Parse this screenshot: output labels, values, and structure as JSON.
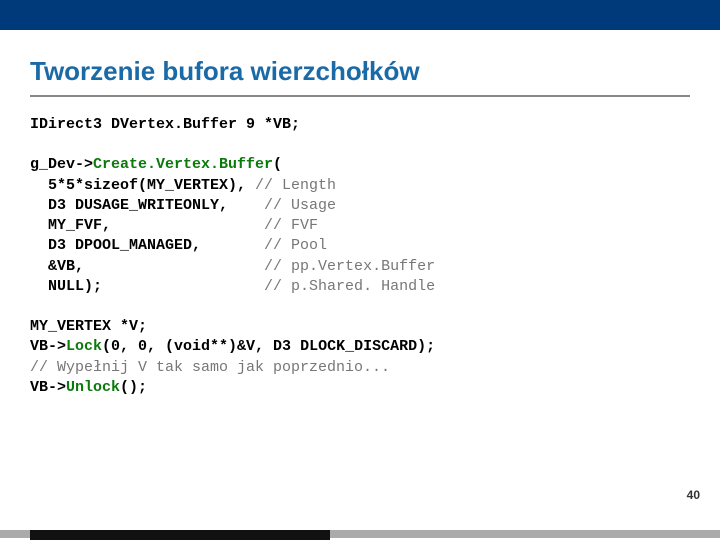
{
  "title": "Tworzenie bufora wierzchołków",
  "page_number": "40",
  "code1": {
    "line": "IDirect3 DVertex.Buffer 9 *VB;"
  },
  "code2": {
    "l1a": "g_Dev->",
    "l1b": "Create.Vertex.Buffer",
    "l1c": "(",
    "l2a": "  5*5*sizeof(MY_VERTEX), ",
    "l2c": "// Length",
    "l3a": "  D3 DUSAGE_WRITEONLY,    ",
    "l3c": "// Usage",
    "l4a": "  MY_FVF,                 ",
    "l4c": "// FVF",
    "l5a": "  D3 DPOOL_MANAGED,       ",
    "l5c": "// Pool",
    "l6a": "  &VB,                    ",
    "l6c": "// pp.Vertex.Buffer",
    "l7a": "  NULL);                  ",
    "l7c": "// p.Shared. Handle"
  },
  "code3": {
    "l1": "MY_VERTEX *V;",
    "l2a": "VB->",
    "l2b": "Lock",
    "l2c": "(0, 0, (void**)&V, D3 DLOCK_DISCARD);",
    "l3": "// Wypełnij V tak samo jak poprzednio...",
    "l4a": "VB->",
    "l4b": "Unlock",
    "l4c": "();"
  }
}
